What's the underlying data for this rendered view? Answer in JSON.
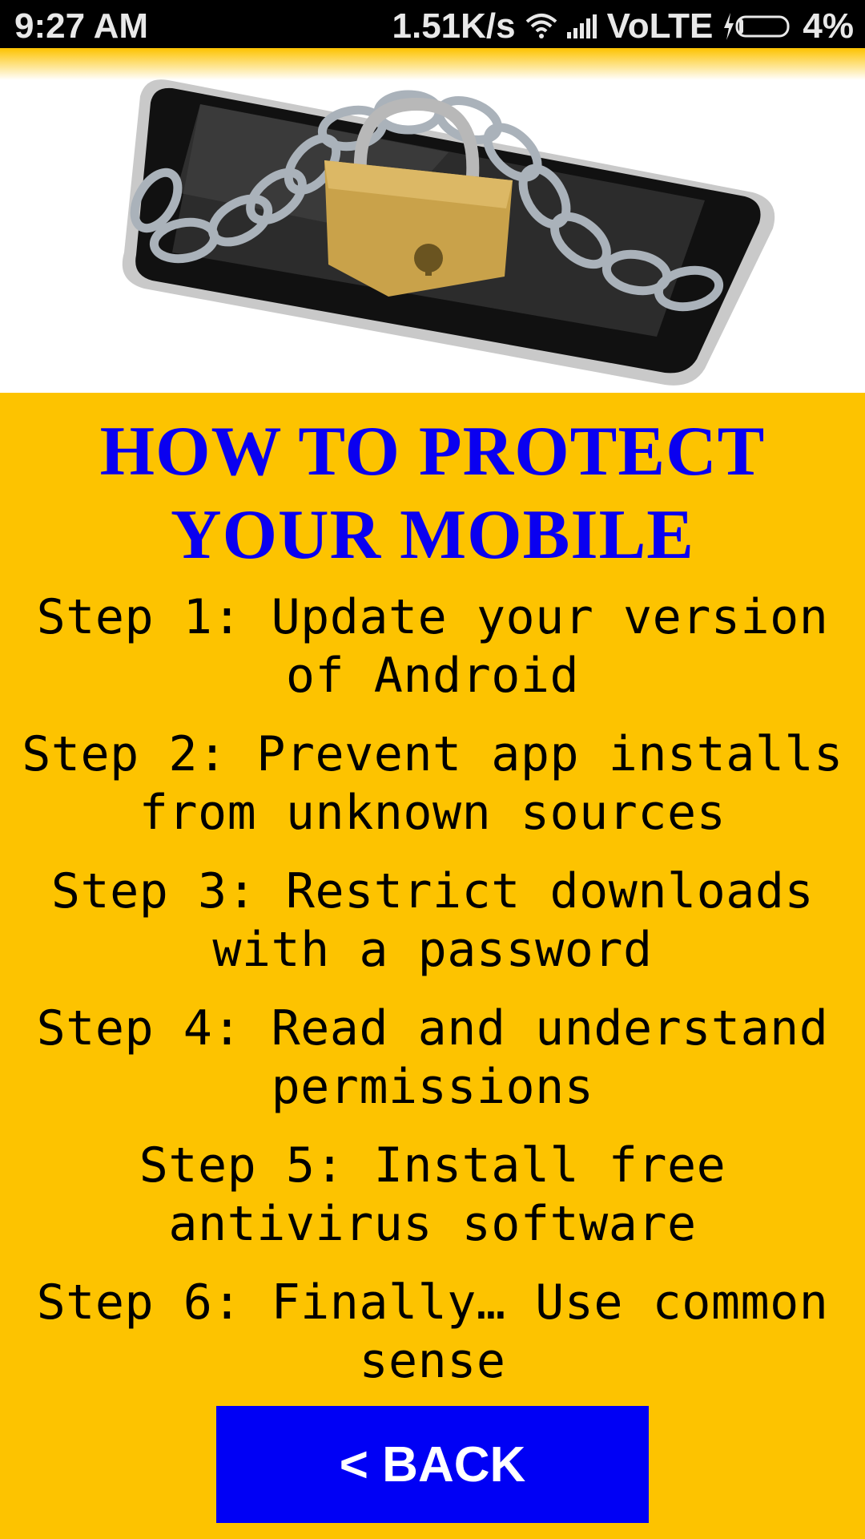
{
  "status_bar": {
    "time": "9:27 AM",
    "network_speed": "1.51K/s",
    "network_type": "VoLTE",
    "battery": "4%",
    "icons": [
      "wifi-icon",
      "signal-icon",
      "charging-icon",
      "battery-icon"
    ]
  },
  "hero": {
    "image": "phone-locked-with-chain-and-padlock"
  },
  "main": {
    "title": "HOW TO PROTECT YOUR MOBILE",
    "steps": [
      "Step 1: Update your version of Android",
      "Step 2: Prevent app installs from unknown sources",
      "Step 3: Restrict downloads with a password",
      "Step 4: Read and understand permissions",
      "Step 5: Install free antivirus software",
      "Step 6: Finally… Use common sense"
    ],
    "back_label": "< BACK"
  },
  "colors": {
    "background": "#fdc300",
    "title": "#0a00f0",
    "button": "#0000f5",
    "status_bar": "#000000"
  }
}
